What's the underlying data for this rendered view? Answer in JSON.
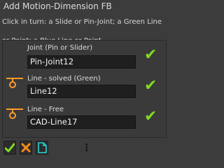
{
  "title": "Add Motion-Dimension FB",
  "instruction": "Click in turn: a Slide or Pin-Joint; a Green Line or Point; a Blue Line or Point",
  "rows": [
    {
      "label": "Joint (Pin or Slider)",
      "value": "Pin-Joint12"
    },
    {
      "label": "Line - solved (Green)",
      "value": "Line12"
    },
    {
      "label": "Line - Free",
      "value": "CAD-Line17"
    }
  ],
  "colors": {
    "check": "#7fdc1f",
    "handle": "#ff9a2e",
    "cancel": "#ff8a1a",
    "new_doc": "#27d4d4"
  },
  "icons": [
    "check-icon",
    "line-handle-icon",
    "ok-icon",
    "cancel-icon",
    "new-document-icon",
    "text-cursor-icon"
  ]
}
